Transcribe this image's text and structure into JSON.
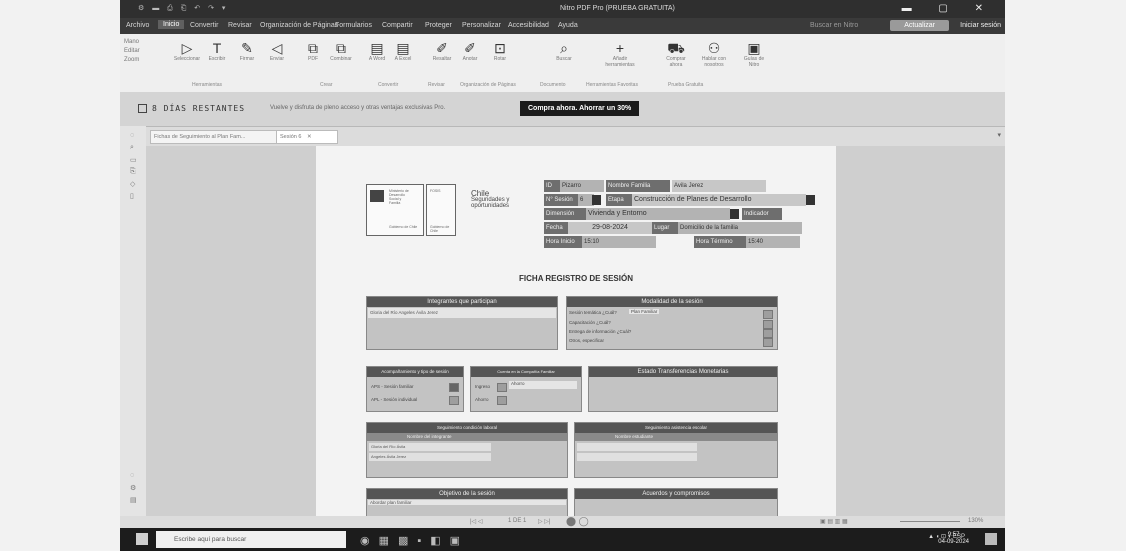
{
  "window": {
    "title": "Nitro PDF Pro (PRUEBA GRATUITA)",
    "quick_access": "⚙ ▬ ⎙ ⎗ ↶ ↷ ▾",
    "controls": "▬ ▢ ✕"
  },
  "menu": {
    "items": [
      "Archivo",
      "Inicio",
      "Convertir",
      "Revisar",
      "Organización de Páginas",
      "Formularios",
      "Compartir",
      "Proteger",
      "Personalizar",
      "Accesibilidad",
      "Ayuda"
    ],
    "active": "Inicio",
    "search_placeholder": "Buscar en Nitro",
    "upgrade_label": "Actualizar",
    "signin_label": "Iniciar sesión"
  },
  "ribbon": {
    "left_tools": [
      "Mano",
      "Editar",
      "Zoom"
    ],
    "buttons": [
      {
        "icon": "▷",
        "label": "Seleccionar"
      },
      {
        "icon": "T",
        "label": "Escribir"
      },
      {
        "icon": "✎",
        "label": "Firmar"
      },
      {
        "icon": "◁",
        "label": "Enviar"
      },
      {
        "icon": "⧉",
        "label": "PDF"
      },
      {
        "icon": "⧉",
        "label": "Combinar"
      },
      {
        "icon": "▤",
        "label": "A Word"
      },
      {
        "icon": "▤",
        "label": "A Excel"
      },
      {
        "icon": "✐",
        "label": "Resaltar"
      },
      {
        "icon": "✐",
        "label": "Anotar"
      },
      {
        "icon": "⊡",
        "label": "Rotar"
      },
      {
        "icon": "⌕",
        "label": "Buscar"
      },
      {
        "icon": "+",
        "label": "Añadir herramientas"
      },
      {
        "icon": "⛟",
        "label": "Comprar ahora"
      },
      {
        "icon": "⚇",
        "label": "Hablar con nosotros"
      },
      {
        "icon": "▣",
        "label": "Guías de Nitro"
      }
    ],
    "groups": [
      "Herramientas",
      "Crear",
      "Convertir",
      "Revisar",
      "Organización de Páginas",
      "Documento",
      "Herramientas Favoritas",
      "Prueba Gratuita"
    ]
  },
  "banner": {
    "days": "8 DÍAS RESTANTES",
    "message": "Vuelve y disfruta de pleno acceso y otras ventajas exclusivas Pro.",
    "cta": "Compra ahora. Ahorrar un 30%"
  },
  "tabs": [
    {
      "label": "Fichas de Seguimiento al Plan Fam...",
      "closable": true
    },
    {
      "label": "Sesión 6",
      "closable": true
    }
  ],
  "document": {
    "logo_text": [
      "Ministerio de",
      "Desarrollo",
      "Social y",
      "Familia",
      "Gobierno de Chile"
    ],
    "logo2_text": [
      "FOSIS",
      "Gobierno de Chile"
    ],
    "chile_text": [
      "Chile",
      "Seguridades y",
      "oportunidades"
    ],
    "fields": {
      "id_label": "ID",
      "id_value": "Pizarro",
      "family_label": "Nombre Familia",
      "family_value": "Avila Jerez",
      "session_label": "N° Sesión",
      "session_value": "6",
      "stage_label": "Etapa",
      "stage_value": "Construcción de Planes de Desarrollo",
      "dimension_label": "Dimensión",
      "dimension_value": "Vivienda y Entorno",
      "indicator_label": "Indicador",
      "date_label": "Fecha",
      "date_value": "29-08-2024",
      "place_label": "Lugar",
      "place_value": "Domicilio de la familia",
      "start_label": "Hora Inicio",
      "start_value": "15:10",
      "end_label": "Hora Término",
      "end_value": "15:40"
    },
    "title": "FICHA REGISTRO DE SESIÓN",
    "participants": {
      "header": "Integrantes que participan",
      "value": "Gloria del Río Angeles Ávila Jerez"
    },
    "modality": {
      "header": "Modalidad de la sesión",
      "items": [
        "Sesión temática ¿Cuál?",
        "Capacitación ¿Cuál?",
        "Entrega de información ¿Cuál?",
        "Otros, especificar"
      ],
      "first_value": "Plan Familiar"
    },
    "accompaniment": {
      "header": "Acompañamiento y tipo de sesión",
      "items": [
        "APS - Sesión familiar",
        "APL - Sesión individual"
      ]
    },
    "savings": {
      "header": "Cuenta en la Compañía Familiar",
      "items": [
        "Ingreso",
        "Ahorro"
      ],
      "value": "Ahorro"
    },
    "transfers": {
      "header": "Estado Transferencias Monetarias"
    },
    "tracking_left": {
      "header": "Seguimiento condición laboral",
      "subheader": "Nombre del integrante",
      "rows": [
        "Gloria del Río Ávila",
        "Angeles Ávila Jerez"
      ]
    },
    "tracking_right": {
      "header": "Seguimiento asistencia escolar",
      "subheader": "Nombre estudiante"
    },
    "objective": {
      "header": "Objetivo de la sesión",
      "value": "Abordar plan familiar"
    },
    "agreements": {
      "header": "Acuerdos y compromisos"
    }
  },
  "statusbar": {
    "page": "1 DE 1",
    "zoom": "130%"
  },
  "taskbar": {
    "search_placeholder": "Escribe aquí para buscar",
    "time": "9:57",
    "date": "04-09-2024",
    "lang": "ESP"
  }
}
